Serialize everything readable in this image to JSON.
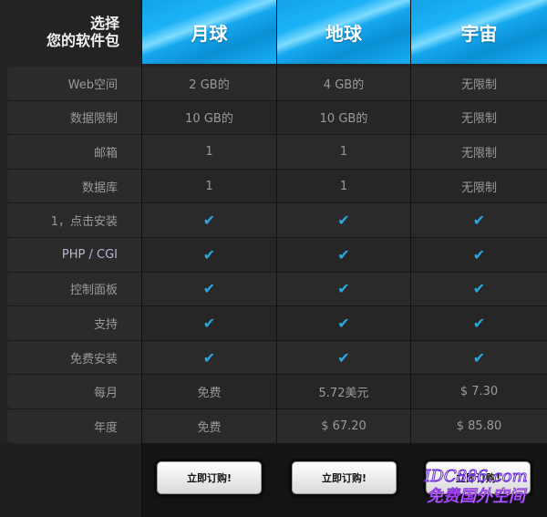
{
  "labels": {
    "title_line1": "选择",
    "title_line2": "您的软件包",
    "rows": [
      "Web空间",
      "数据限制",
      "邮箱",
      "数据库",
      "1，点击安装",
      "PHP / CGI",
      "控制面板",
      "支持",
      "免费安装",
      "每月",
      "年度"
    ]
  },
  "plans": [
    {
      "name": "月球",
      "rows": [
        "2 GB的",
        "10 GB的",
        "1",
        "1",
        "✔",
        "✔",
        "✔",
        "✔",
        "✔",
        "免费",
        "免费"
      ],
      "button": "立即订购!"
    },
    {
      "name": "地球",
      "rows": [
        "4 GB的",
        "10 GB的",
        "1",
        "1",
        "✔",
        "✔",
        "✔",
        "✔",
        "✔",
        "5.72美元",
        "$ 67.20"
      ],
      "button": "立即订购!"
    },
    {
      "name": "宇宙",
      "rows": [
        "无限制",
        "无限制",
        "无限制",
        "无限制",
        "✔",
        "✔",
        "✔",
        "✔",
        "✔",
        "$ 7.30",
        "$ 85.80"
      ],
      "button": "立即订购!"
    }
  ],
  "watermark": {
    "line1": "IDC886.com",
    "line2": "免费国外空间"
  },
  "colors": {
    "header_blue": "#1cb2f6",
    "check": "#28a9e6",
    "background": "#1c1c1c"
  }
}
